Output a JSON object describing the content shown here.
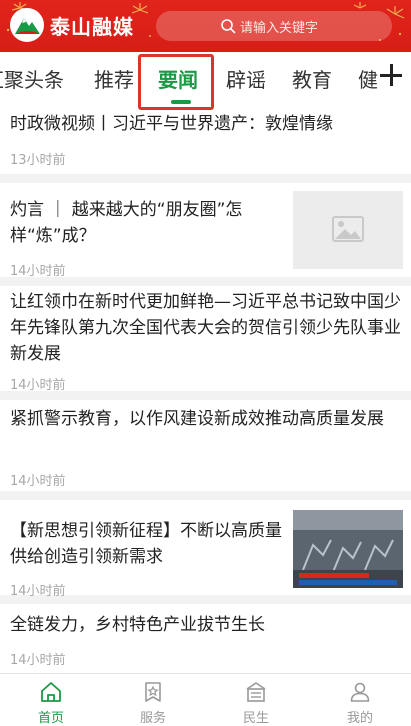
{
  "header": {
    "app_name": "泰山融媒",
    "search_placeholder": "请输入关键字",
    "brand_color": "#d71e16"
  },
  "tabs": [
    {
      "label": "汇聚头条",
      "active": false
    },
    {
      "label": "推荐",
      "active": false
    },
    {
      "label": "要闻",
      "active": true
    },
    {
      "label": "辟谣",
      "active": false
    },
    {
      "label": "教育",
      "active": false
    },
    {
      "label": "健",
      "active": false
    }
  ],
  "accent_color": "#1a9a45",
  "feed": [
    {
      "title": "时政微视频丨习近平与世界遗产：敦煌情缘",
      "time": "13小时前",
      "thumb": "none"
    },
    {
      "title": "灼言 ｜ 越来越大的“朋友圈”怎样“炼”成？",
      "time": "14小时前",
      "thumb": "placeholder-image"
    },
    {
      "title": "让红领巾在新时代更加鲜艳—习近平总书记致中国少年先锋队第九次全国代表大会的贺信引领少先队事业新发展",
      "time": "14小时前",
      "thumb": "none"
    },
    {
      "title": "紧抓警示教育，以作风建设新成效推动高质量发展",
      "time": "14小时前",
      "thumb": "none"
    },
    {
      "title": "【新思想引领新征程】不断以高质量供给创造引领新需求",
      "time": "14小时前",
      "thumb": "factory-photo"
    },
    {
      "title": "全链发力，乡村特色产业拔节生长",
      "time": "14小时前",
      "thumb": "none"
    }
  ],
  "bottom_nav": [
    {
      "label": "首页",
      "icon": "home-icon",
      "active": true
    },
    {
      "label": "服务",
      "icon": "service-icon",
      "active": false
    },
    {
      "label": "民生",
      "icon": "livelihood-icon",
      "active": false
    },
    {
      "label": "我的",
      "icon": "profile-icon",
      "active": false
    }
  ]
}
